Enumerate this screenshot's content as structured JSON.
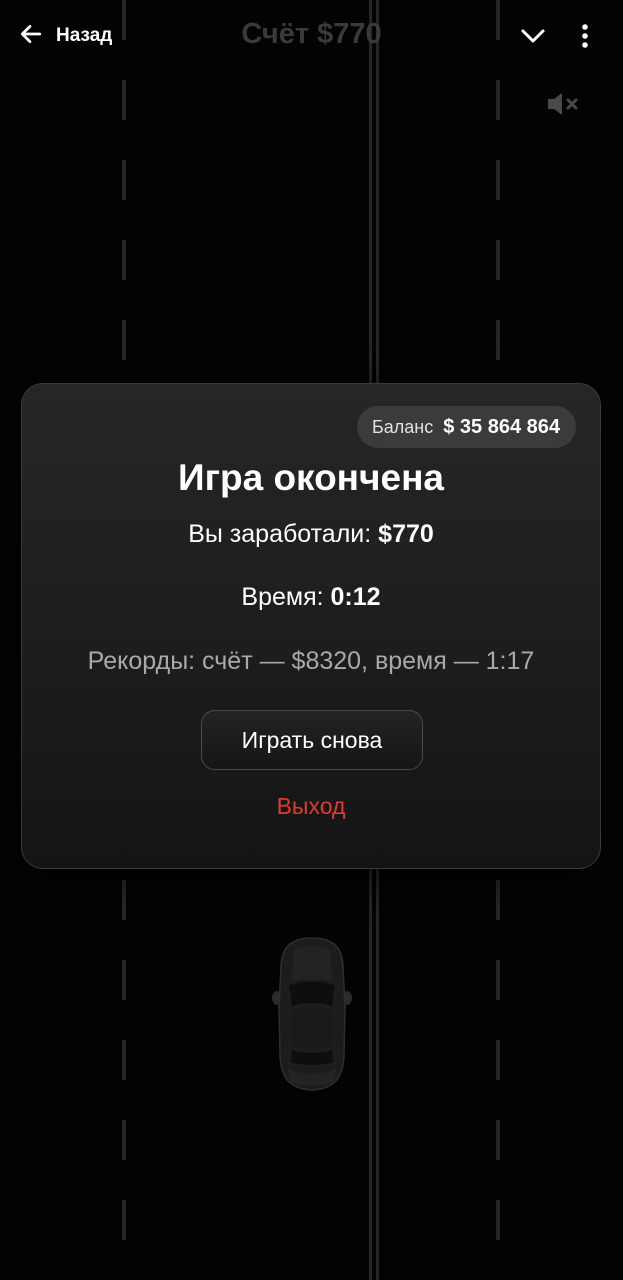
{
  "topbar": {
    "back_label": "Назад",
    "score_title": "Счёт $770",
    "icons": {
      "back": "arrow-left-icon",
      "chevron": "chevron-down-icon",
      "more": "more-vertical-icon",
      "mute": "volume-muted-icon"
    }
  },
  "modal": {
    "balance_label": "Баланс",
    "balance_value": "$ 35 864 864",
    "title": "Игра окончена",
    "earned_label": "Вы заработали:",
    "earned_value": "$770",
    "time_label": "Время:",
    "time_value": "0:12",
    "records_text": "Рекорды: счёт — $8320, время — 1:17",
    "play_again_label": "Играть снова",
    "exit_label": "Выход"
  },
  "colors": {
    "background": "#030303",
    "panel": "#1d1d1d",
    "exit_red": "#e13b2e",
    "muted_title": "#3a3a3a"
  }
}
